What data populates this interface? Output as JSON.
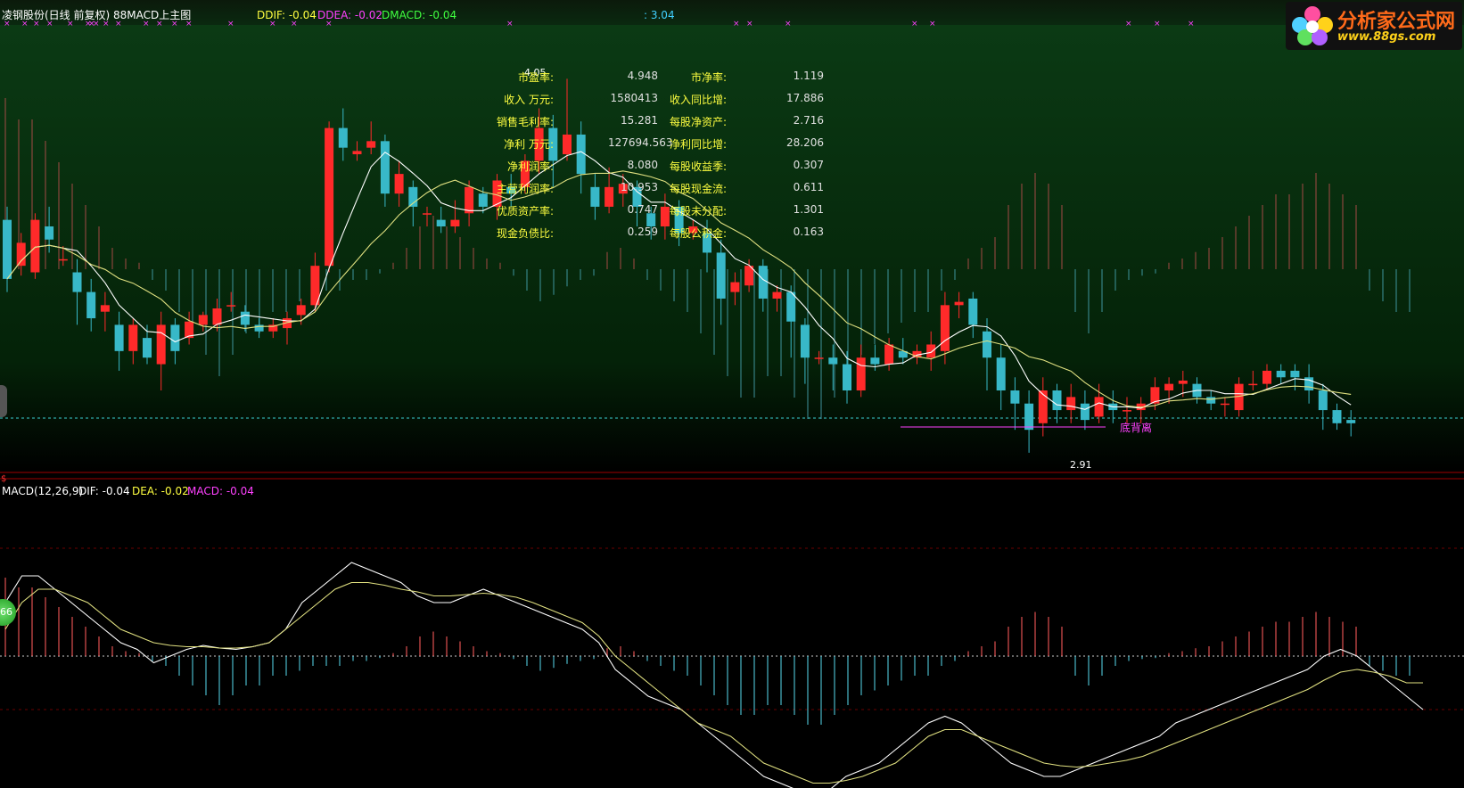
{
  "main_panel": {
    "title": "凌钢股份(日线 前复权) 88MACD上主图",
    "ddif": "DDIF: -0.04",
    "ddea": "DDEA: -0.02",
    "dmacd": "DMACD: -0.04",
    "extra_value": ": 3.04",
    "high_label": "4.05",
    "low_label": "2.91",
    "divergence_label": "底背离",
    "dollar_marker": "$"
  },
  "macd_panel": {
    "title": "MACD(12,26,9)",
    "dif": "DIF: -0.04",
    "dea": "DEA: -0.02",
    "macd": "MACD: -0.04"
  },
  "side_badge": "66",
  "logo": {
    "text": "分析家公式网",
    "url": "www.88gs.com"
  },
  "financials": [
    {
      "label": "市盈率:",
      "value": "4.948",
      "label2": "市净率:",
      "value2": "1.119"
    },
    {
      "label": "收入 万元:",
      "value": "1580413",
      "label2": "收入同比增:",
      "value2": "17.886"
    },
    {
      "label": "销售毛利率:",
      "value": "15.281",
      "label2": "每股净资产:",
      "value2": "2.716"
    },
    {
      "label": "净利 万元:",
      "value": "127694.563",
      "label2": "净利同比增:",
      "value2": "28.206"
    },
    {
      "label": "净利润率:",
      "value": "8.080",
      "label2": "每股收益季:",
      "value2": "0.307"
    },
    {
      "label": "主营利润率:",
      "value": "10.953",
      "label2": "每股现金流:",
      "value2": "0.611"
    },
    {
      "label": "优质资产率:",
      "value": "0.747",
      "label2": "每股未分配:",
      "value2": "1.301"
    },
    {
      "label": "现金负债比:",
      "value": "0.259",
      "label2": "每股公积金:",
      "value2": "0.163"
    }
  ],
  "colors": {
    "up": "#ff2a2a",
    "down": "#38b8c8",
    "dif": "#ffffff",
    "dea": "#e0e080",
    "macd": "#ff40ff",
    "ddif_color": "#ffff40",
    "dmacd_color": "#40ff40"
  },
  "chart_data": {
    "type": "candlestick",
    "candles": [
      [
        3.62,
        3.44,
        3.66,
        3.4
      ],
      [
        3.48,
        3.55,
        3.58,
        3.45
      ],
      [
        3.46,
        3.62,
        3.64,
        3.44
      ],
      [
        3.6,
        3.56,
        3.66,
        3.52
      ],
      [
        3.5,
        3.5,
        3.54,
        3.48
      ],
      [
        3.46,
        3.4,
        3.5,
        3.3
      ],
      [
        3.4,
        3.32,
        3.44,
        3.28
      ],
      [
        3.34,
        3.36,
        3.4,
        3.28
      ],
      [
        3.3,
        3.22,
        3.34,
        3.16
      ],
      [
        3.22,
        3.3,
        3.32,
        3.18
      ],
      [
        3.26,
        3.2,
        3.3,
        3.18
      ],
      [
        3.18,
        3.3,
        3.34,
        3.1
      ],
      [
        3.3,
        3.22,
        3.32,
        3.18
      ],
      [
        3.26,
        3.31,
        3.34,
        3.24
      ],
      [
        3.3,
        3.33,
        3.34,
        3.28
      ],
      [
        3.3,
        3.35,
        3.38,
        3.28
      ],
      [
        3.36,
        3.36,
        3.4,
        3.34
      ],
      [
        3.34,
        3.3,
        3.36,
        3.28
      ],
      [
        3.3,
        3.28,
        3.32,
        3.26
      ],
      [
        3.28,
        3.3,
        3.32,
        3.26
      ],
      [
        3.29,
        3.32,
        3.34,
        3.24
      ],
      [
        3.33,
        3.36,
        3.38,
        3.3
      ],
      [
        3.36,
        3.48,
        3.52,
        3.34
      ],
      [
        3.48,
        3.9,
        3.92,
        3.46
      ],
      [
        3.9,
        3.84,
        3.96,
        3.8
      ],
      [
        3.82,
        3.83,
        3.86,
        3.8
      ],
      [
        3.84,
        3.86,
        3.92,
        3.82
      ],
      [
        3.86,
        3.7,
        3.88,
        3.66
      ],
      [
        3.7,
        3.76,
        3.8,
        3.66
      ],
      [
        3.72,
        3.66,
        3.74,
        3.6
      ],
      [
        3.64,
        3.64,
        3.66,
        3.6
      ],
      [
        3.62,
        3.6,
        3.66,
        3.58
      ],
      [
        3.6,
        3.62,
        3.68,
        3.58
      ],
      [
        3.64,
        3.72,
        3.74,
        3.6
      ],
      [
        3.7,
        3.66,
        3.72,
        3.64
      ],
      [
        3.66,
        3.74,
        3.76,
        3.62
      ],
      [
        3.72,
        3.7,
        3.76,
        3.66
      ],
      [
        3.72,
        3.8,
        3.82,
        3.7
      ],
      [
        3.8,
        3.9,
        3.96,
        3.76
      ],
      [
        3.9,
        3.8,
        3.94,
        3.72
      ],
      [
        3.82,
        3.88,
        4.05,
        3.8
      ],
      [
        3.88,
        3.76,
        3.92,
        3.7
      ],
      [
        3.72,
        3.66,
        3.76,
        3.62
      ],
      [
        3.66,
        3.72,
        3.78,
        3.64
      ],
      [
        3.7,
        3.73,
        3.76,
        3.66
      ],
      [
        3.72,
        3.66,
        3.74,
        3.6
      ],
      [
        3.64,
        3.6,
        3.66,
        3.56
      ],
      [
        3.6,
        3.66,
        3.7,
        3.56
      ],
      [
        3.66,
        3.58,
        3.68,
        3.54
      ],
      [
        3.58,
        3.6,
        3.62,
        3.56
      ],
      [
        3.58,
        3.52,
        3.62,
        3.46
      ],
      [
        3.52,
        3.38,
        3.56,
        3.3
      ],
      [
        3.4,
        3.43,
        3.46,
        3.36
      ],
      [
        3.42,
        3.48,
        3.5,
        3.4
      ],
      [
        3.48,
        3.38,
        3.5,
        3.34
      ],
      [
        3.38,
        3.4,
        3.42,
        3.34
      ],
      [
        3.4,
        3.31,
        3.42,
        3.2
      ],
      [
        3.3,
        3.2,
        3.32,
        3.12
      ],
      [
        3.2,
        3.2,
        3.22,
        3.18
      ],
      [
        3.2,
        3.18,
        3.24,
        3.1
      ],
      [
        3.18,
        3.1,
        3.22,
        3.06
      ],
      [
        3.1,
        3.2,
        3.24,
        3.08
      ],
      [
        3.2,
        3.18,
        3.24,
        3.16
      ],
      [
        3.18,
        3.24,
        3.26,
        3.16
      ],
      [
        3.22,
        3.2,
        3.26,
        3.18
      ],
      [
        3.2,
        3.22,
        3.24,
        3.18
      ],
      [
        3.2,
        3.24,
        3.28,
        3.16
      ],
      [
        3.22,
        3.36,
        3.4,
        3.18
      ],
      [
        3.36,
        3.37,
        3.4,
        3.32
      ],
      [
        3.38,
        3.3,
        3.4,
        3.26
      ],
      [
        3.28,
        3.2,
        3.32,
        3.1
      ],
      [
        3.2,
        3.1,
        3.24,
        3.04
      ],
      [
        3.1,
        3.06,
        3.14,
        2.98
      ],
      [
        3.06,
        2.98,
        3.1,
        2.91
      ],
      [
        3.0,
        3.1,
        3.14,
        2.96
      ],
      [
        3.1,
        3.04,
        3.12,
        3.0
      ],
      [
        3.04,
        3.08,
        3.12,
        3.0
      ],
      [
        3.06,
        3.01,
        3.1,
        2.98
      ],
      [
        3.02,
        3.08,
        3.12,
        3.0
      ],
      [
        3.06,
        3.04,
        3.1,
        3.0
      ],
      [
        3.04,
        3.04,
        3.08,
        3.0
      ],
      [
        3.04,
        3.06,
        3.08,
        3.0
      ],
      [
        3.06,
        3.11,
        3.14,
        3.04
      ],
      [
        3.1,
        3.12,
        3.14,
        3.06
      ],
      [
        3.12,
        3.13,
        3.16,
        3.08
      ],
      [
        3.12,
        3.08,
        3.14,
        3.06
      ],
      [
        3.08,
        3.06,
        3.1,
        3.04
      ],
      [
        3.06,
        3.06,
        3.08,
        3.02
      ],
      [
        3.04,
        3.12,
        3.14,
        3.02
      ],
      [
        3.12,
        3.12,
        3.16,
        3.1
      ],
      [
        3.12,
        3.16,
        3.18,
        3.1
      ],
      [
        3.16,
        3.14,
        3.18,
        3.12
      ],
      [
        3.16,
        3.14,
        3.18,
        3.1
      ],
      [
        3.14,
        3.1,
        3.18,
        3.06
      ],
      [
        3.1,
        3.04,
        3.12,
        2.98
      ],
      [
        3.04,
        3.0,
        3.06,
        2.98
      ],
      [
        3.01,
        3.0,
        3.04,
        2.96
      ]
    ]
  },
  "macd_chart": {
    "type": "bar",
    "x_start": 0,
    "ylim": [
      -0.12,
      0.1
    ],
    "hist": [
      0.08,
      0.07,
      0.07,
      0.06,
      0.05,
      0.04,
      0.03,
      0.02,
      0.01,
      0.005,
      0.003,
      -0.005,
      -0.01,
      -0.02,
      -0.03,
      -0.04,
      -0.05,
      -0.04,
      -0.03,
      -0.03,
      -0.02,
      -0.02,
      -0.015,
      -0.01,
      -0.01,
      -0.01,
      -0.005,
      -0.005,
      -0.002,
      0.003,
      0.01,
      0.02,
      0.025,
      0.02,
      0.015,
      0.01,
      0.005,
      0.003,
      -0.003,
      -0.01,
      -0.015,
      -0.012,
      -0.008,
      -0.005,
      -0.003,
      0.008,
      0.01,
      0.005,
      -0.005,
      -0.01,
      -0.015,
      -0.02,
      -0.03,
      -0.04,
      -0.05,
      -0.06,
      -0.06,
      -0.05,
      -0.05,
      -0.06,
      -0.07,
      -0.07,
      -0.06,
      -0.05,
      -0.04,
      -0.035,
      -0.03,
      -0.025,
      -0.02,
      -0.02,
      -0.01,
      -0.005,
      0.005,
      0.01,
      0.015,
      0.03,
      0.04,
      0.045,
      0.04,
      0.03,
      -0.02,
      -0.03,
      -0.02,
      -0.01,
      -0.005,
      -0.003,
      -0.002,
      0.003,
      0.005,
      0.008,
      0.01,
      0.015,
      0.02,
      0.025,
      0.03,
      0.035,
      0.035,
      0.04,
      0.045,
      0.04,
      0.035,
      0.03,
      -0.01,
      -0.015,
      -0.02,
      -0.02
    ],
    "dif": [
      0.04,
      0.06,
      0.06,
      0.05,
      0.04,
      0.03,
      0.02,
      0.01,
      0.005,
      -0.005,
      0.0,
      0.005,
      0.008,
      0.006,
      0.005,
      0.007,
      0.01,
      0.02,
      0.04,
      0.05,
      0.06,
      0.07,
      0.065,
      0.06,
      0.055,
      0.045,
      0.04,
      0.04,
      0.045,
      0.05,
      0.045,
      0.04,
      0.035,
      0.03,
      0.025,
      0.02,
      0.01,
      -0.01,
      -0.02,
      -0.03,
      -0.035,
      -0.04,
      -0.05,
      -0.06,
      -0.07,
      -0.08,
      -0.09,
      -0.095,
      -0.1,
      -0.105,
      -0.1,
      -0.09,
      -0.085,
      -0.08,
      -0.07,
      -0.06,
      -0.05,
      -0.045,
      -0.05,
      -0.06,
      -0.07,
      -0.08,
      -0.085,
      -0.09,
      -0.09,
      -0.085,
      -0.08,
      -0.075,
      -0.07,
      -0.065,
      -0.06,
      -0.05,
      -0.045,
      -0.04,
      -0.035,
      -0.03,
      -0.025,
      -0.02,
      -0.015,
      -0.01,
      0.0,
      0.005,
      0.0,
      -0.01,
      -0.02,
      -0.03,
      -0.04
    ],
    "dea": [
      0.02,
      0.04,
      0.05,
      0.05,
      0.045,
      0.04,
      0.03,
      0.02,
      0.015,
      0.01,
      0.008,
      0.007,
      0.007,
      0.006,
      0.006,
      0.007,
      0.01,
      0.02,
      0.03,
      0.04,
      0.05,
      0.055,
      0.055,
      0.053,
      0.05,
      0.048,
      0.045,
      0.045,
      0.046,
      0.047,
      0.046,
      0.044,
      0.04,
      0.035,
      0.03,
      0.025,
      0.015,
      0.0,
      -0.01,
      -0.02,
      -0.03,
      -0.04,
      -0.05,
      -0.055,
      -0.06,
      -0.07,
      -0.08,
      -0.085,
      -0.09,
      -0.095,
      -0.095,
      -0.093,
      -0.09,
      -0.085,
      -0.08,
      -0.07,
      -0.06,
      -0.055,
      -0.055,
      -0.06,
      -0.065,
      -0.07,
      -0.075,
      -0.08,
      -0.082,
      -0.083,
      -0.082,
      -0.08,
      -0.078,
      -0.075,
      -0.07,
      -0.065,
      -0.06,
      -0.055,
      -0.05,
      -0.045,
      -0.04,
      -0.035,
      -0.03,
      -0.025,
      -0.018,
      -0.012,
      -0.01,
      -0.012,
      -0.015,
      -0.02,
      -0.02
    ]
  }
}
